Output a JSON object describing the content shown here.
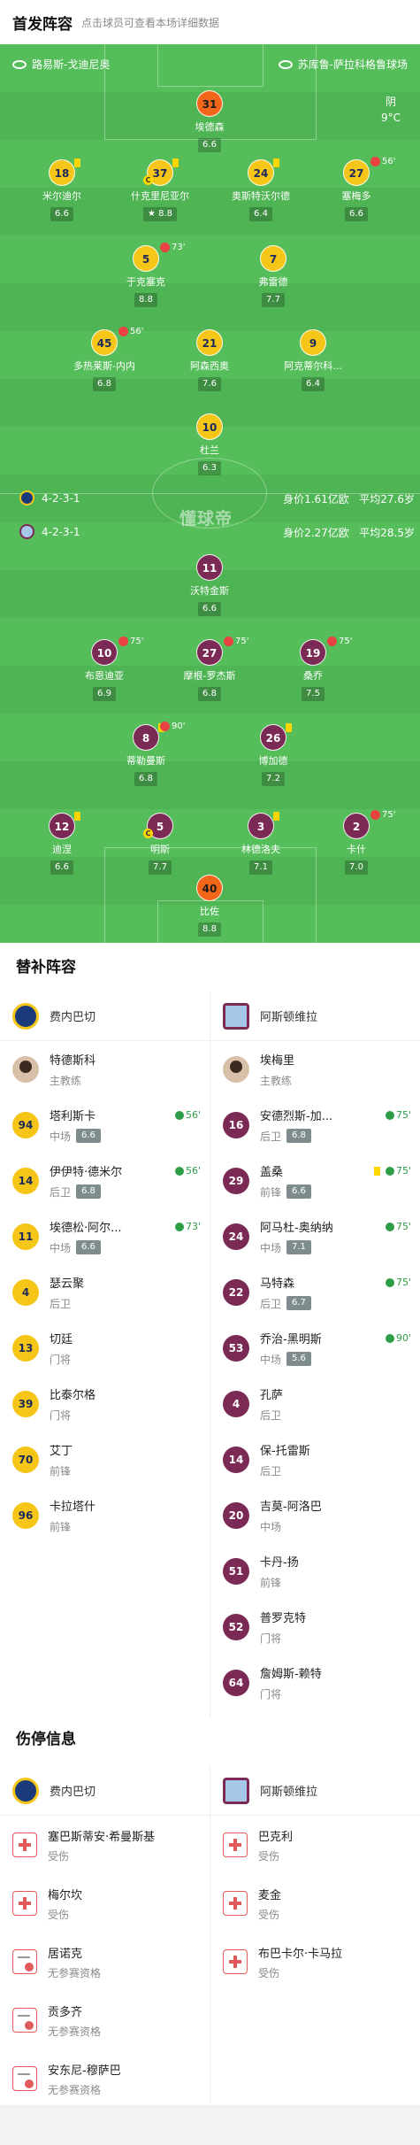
{
  "header": {
    "title": "首发阵容",
    "subtitle": "点击球员可查看本场详细数据"
  },
  "pitch": {
    "home_venue": "路易斯-戈迪尼奥",
    "away_venue": "苏库鲁-萨拉科格鲁球场",
    "weather": {
      "condition": "阴",
      "temp": "9°C"
    },
    "watermark": "懂球帝",
    "home_formation": "4-2-3-1",
    "home_value": "身价1.61亿欧",
    "home_age": "平均27.6岁",
    "away_formation": "4-2-3-1",
    "away_value": "身价2.27亿欧",
    "away_age": "平均28.5岁",
    "home_players": [
      {
        "num": "31",
        "name": "埃德森",
        "rating": "6.6",
        "gk": true
      },
      {
        "num": "18",
        "name": "米尔迪尔",
        "rating": "6.6",
        "yellow": true
      },
      {
        "num": "37",
        "name": "什克里尼亚尔",
        "rating": "8.8",
        "yellow": true,
        "captain": true,
        "star": true
      },
      {
        "num": "24",
        "name": "奥斯特沃尔德",
        "rating": "6.4",
        "yellow": true
      },
      {
        "num": "27",
        "name": "塞梅多",
        "rating": "6.6",
        "sub_time": "56'"
      },
      {
        "num": "5",
        "name": "于克塞克",
        "rating": "8.8",
        "sub_time": "73'"
      },
      {
        "num": "7",
        "name": "弗雷德",
        "rating": "7.7"
      },
      {
        "num": "45",
        "name": "多热莱斯-内内",
        "rating": "6.8",
        "sub_time": "56'"
      },
      {
        "num": "21",
        "name": "阿森西奥",
        "rating": "7.6"
      },
      {
        "num": "9",
        "name": "阿克蒂尔科...",
        "rating": "6.4"
      },
      {
        "num": "10",
        "name": "杜兰",
        "rating": "6.3"
      }
    ],
    "away_players": [
      {
        "num": "11",
        "name": "沃特金斯",
        "rating": "6.6"
      },
      {
        "num": "10",
        "name": "布恩迪亚",
        "rating": "6.9",
        "sub_time": "75'"
      },
      {
        "num": "27",
        "name": "摩根-罗杰斯",
        "rating": "6.8",
        "sub_time": "75'"
      },
      {
        "num": "19",
        "name": "桑乔",
        "rating": "7.5",
        "sub_time": "75'"
      },
      {
        "num": "8",
        "name": "蒂勒曼斯",
        "rating": "6.8",
        "yellow": true,
        "sub_time": "90'"
      },
      {
        "num": "26",
        "name": "博加德",
        "rating": "7.2",
        "yellow": true
      },
      {
        "num": "12",
        "name": "迪涅",
        "rating": "6.6",
        "yellow": true
      },
      {
        "num": "5",
        "name": "明斯",
        "rating": "7.7",
        "captain": true
      },
      {
        "num": "3",
        "name": "林德洛夫",
        "rating": "7.1",
        "yellow": true
      },
      {
        "num": "2",
        "name": "卡什",
        "rating": "7.0",
        "sub_time": "75'"
      },
      {
        "num": "40",
        "name": "比佐",
        "rating": "8.8",
        "gk": true
      }
    ]
  },
  "subs": {
    "title": "替补阵容",
    "home_team": "费内巴切",
    "away_team": "阿斯顿维拉",
    "home_coach": {
      "name": "特德斯科",
      "role": "主教练"
    },
    "away_coach": {
      "name": "埃梅里",
      "role": "主教练"
    },
    "home": [
      {
        "num": "94",
        "name": "塔利斯卡",
        "pos": "中场",
        "rating": "6.6",
        "in": "56'"
      },
      {
        "num": "14",
        "name": "伊伊特·德米尔",
        "pos": "后卫",
        "rating": "6.8",
        "in": "56'"
      },
      {
        "num": "11",
        "name": "埃德松·阿尔...",
        "pos": "中场",
        "rating": "6.6",
        "in": "73'"
      },
      {
        "num": "4",
        "name": "瑟云聚",
        "pos": "后卫"
      },
      {
        "num": "13",
        "name": "切廷",
        "pos": "门将"
      },
      {
        "num": "39",
        "name": "比泰尔格",
        "pos": "门将"
      },
      {
        "num": "70",
        "name": "艾丁",
        "pos": "前锋"
      },
      {
        "num": "96",
        "name": "卡拉塔什",
        "pos": "前锋"
      }
    ],
    "away": [
      {
        "num": "16",
        "name": "安德烈斯-加...",
        "pos": "后卫",
        "rating": "6.8",
        "in": "75'"
      },
      {
        "num": "29",
        "name": "盖桑",
        "pos": "前锋",
        "rating": "6.6",
        "in": "75'",
        "yellow": true
      },
      {
        "num": "24",
        "name": "阿马杜-奥纳纳",
        "pos": "中场",
        "rating": "7.1",
        "in": "75'"
      },
      {
        "num": "22",
        "name": "马特森",
        "pos": "后卫",
        "rating": "6.7",
        "in": "75'"
      },
      {
        "num": "53",
        "name": "乔治-黑明斯",
        "pos": "中场",
        "rating": "5.6",
        "in": "90'"
      },
      {
        "num": "4",
        "name": "孔萨",
        "pos": "后卫"
      },
      {
        "num": "14",
        "name": "保-托雷斯",
        "pos": "后卫"
      },
      {
        "num": "20",
        "name": "吉莫-阿洛巴",
        "pos": "中场"
      },
      {
        "num": "51",
        "name": "卡丹-扬",
        "pos": "前锋"
      },
      {
        "num": "52",
        "name": "普罗克特",
        "pos": "门将"
      },
      {
        "num": "64",
        "name": "詹姆斯-赖特",
        "pos": "门将"
      }
    ]
  },
  "injuries": {
    "title": "伤停信息",
    "home_team": "费内巴切",
    "away_team": "阿斯顿维拉",
    "home": [
      {
        "name": "塞巴斯蒂安·希曼斯基",
        "status": "受伤",
        "type": "injury"
      },
      {
        "name": "梅尔坎",
        "status": "受伤",
        "type": "injury"
      },
      {
        "name": "居诺克",
        "status": "无参赛资格",
        "type": "ban"
      },
      {
        "name": "贡多齐",
        "status": "无参赛资格",
        "type": "ban"
      },
      {
        "name": "安东尼-穆萨巴",
        "status": "无参赛资格",
        "type": "ban"
      }
    ],
    "away": [
      {
        "name": "巴克利",
        "status": "受伤",
        "type": "injury"
      },
      {
        "name": "麦金",
        "status": "受伤",
        "type": "injury"
      },
      {
        "name": "布巴卡尔·卡马拉",
        "status": "受伤",
        "type": "injury"
      }
    ]
  },
  "colors": {
    "pitch": "#55be5a",
    "home_shirt": "#f5c518",
    "away_shirt": "#7a2a55",
    "gk_shirt": "#f2661a"
  }
}
